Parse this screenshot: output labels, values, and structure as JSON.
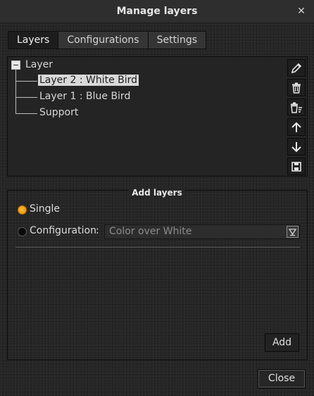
{
  "window": {
    "title": "Manage layers",
    "close_glyph": "✕"
  },
  "tabs": [
    {
      "label": "Layers",
      "active": true
    },
    {
      "label": "Configurations",
      "active": false
    },
    {
      "label": "Settings",
      "active": false
    }
  ],
  "tree": {
    "root_label": "Layer",
    "items": [
      {
        "label": "Layer 2 : White Bird",
        "selected": true
      },
      {
        "label": "Layer 1 : Blue Bird",
        "selected": false
      },
      {
        "label": "Support",
        "selected": false
      }
    ]
  },
  "side_buttons": [
    {
      "icon": "pencil-icon"
    },
    {
      "icon": "trash-icon"
    },
    {
      "icon": "trash-list-icon"
    },
    {
      "icon": "arrow-up-icon"
    },
    {
      "icon": "arrow-down-icon"
    },
    {
      "icon": "save-icon"
    }
  ],
  "add_layers": {
    "legend": "Add layers",
    "single_label": "Single",
    "configuration_label": "Configuration",
    "colon": ":",
    "configuration_value": "Color over White",
    "add_button": "Add"
  },
  "footer": {
    "close_button": "Close"
  },
  "colors": {
    "accent": "#f5a623",
    "selection": "#d9d9d9"
  }
}
